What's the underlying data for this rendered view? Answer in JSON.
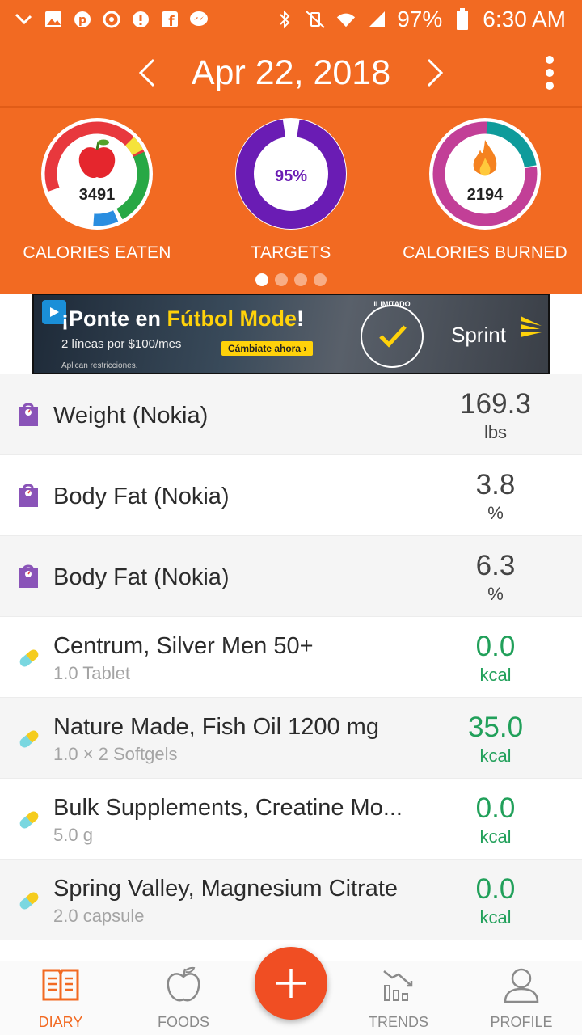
{
  "colors": {
    "brand_orange": "#f26a22",
    "fab_red": "#f04e23",
    "targets_purple": "#6a1cb4",
    "burned_pink": "#c23f97",
    "burned_teal": "#0f9b9b",
    "eaten_red": "#e8383d",
    "eaten_green": "#27a845",
    "eaten_blue": "#2a8ee0",
    "eaten_yellow": "#f5e33b",
    "value_green": "#21a05a"
  },
  "status_bar": {
    "battery": "97%",
    "time": "6:30 AM"
  },
  "header": {
    "date": "Apr 22, 2018"
  },
  "summary": {
    "calories_eaten": {
      "value": "3491",
      "label": "CALORIES EATEN"
    },
    "targets": {
      "value": "95%",
      "label": "TARGETS",
      "fraction": 0.95
    },
    "calories_burned": {
      "value": "2194",
      "label": "CALORIES BURNED"
    },
    "page_indicator": {
      "count": 4,
      "active": 0
    }
  },
  "ad": {
    "headline_prefix": "¡Ponte en ",
    "headline_accent": "Fútbol Mode",
    "headline_suffix": "!",
    "sub": "2 líneas por $100/mes",
    "cta": "Cámbiate ahora ›",
    "legal": "Aplican restricciones.",
    "badge": "ILIMITADO",
    "brand": "Sprint"
  },
  "entries": [
    {
      "icon": "scale-icon",
      "title": "Weight (Nokia)",
      "subtitle": "",
      "value": "169.3",
      "unit": "lbs"
    },
    {
      "icon": "scale-icon",
      "title": "Body Fat (Nokia)",
      "subtitle": "",
      "value": "3.8",
      "unit": "%"
    },
    {
      "icon": "scale-icon",
      "title": "Body Fat (Nokia)",
      "subtitle": "",
      "value": "6.3",
      "unit": "%"
    },
    {
      "icon": "pill-icon",
      "title": "Centrum, Silver Men 50+",
      "subtitle": "1.0 Tablet",
      "value": "0.0",
      "unit": "kcal"
    },
    {
      "icon": "pill-icon",
      "title": "Nature Made, Fish Oil 1200 mg",
      "subtitle": "1.0 × 2 Softgels",
      "value": "35.0",
      "unit": "kcal"
    },
    {
      "icon": "pill-icon",
      "title": "Bulk Supplements, Creatine Mo...",
      "subtitle": "5.0 g",
      "value": "0.0",
      "unit": "kcal"
    },
    {
      "icon": "pill-icon",
      "title": "Spring Valley, Magnesium Citrate",
      "subtitle": "2.0 capsule",
      "value": "0.0",
      "unit": "kcal"
    }
  ],
  "bottom_nav": {
    "diary": "DIARY",
    "foods": "FOODS",
    "trends": "TRENDS",
    "profile": "PROFILE"
  }
}
